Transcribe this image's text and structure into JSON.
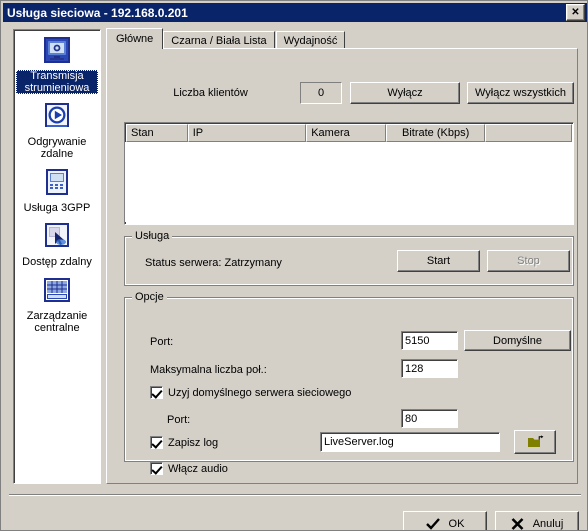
{
  "window": {
    "title": "Usługa sieciowa - 192.168.0.201",
    "close_label": "✕",
    "titlebar_color": "#0a246a",
    "face_color": "#d4d0c8"
  },
  "sidebar": {
    "items": [
      {
        "label": "Transmisja strumieniowa",
        "icon": "streaming-monitor-icon",
        "selected": true
      },
      {
        "label": "Odgrywanie zdalne",
        "icon": "play-circle-icon",
        "selected": false
      },
      {
        "label": "Usługa 3GPP",
        "icon": "mobile-phone-icon",
        "selected": false
      },
      {
        "label": "Dostęp zdalny",
        "icon": "remote-cursor-icon",
        "selected": false
      },
      {
        "label": "Zarządzanie centralne",
        "icon": "server-rack-icon",
        "selected": false
      }
    ]
  },
  "tabs": [
    {
      "label": "Główne",
      "active": true
    },
    {
      "label": "Czarna / Biała Lista",
      "active": false
    },
    {
      "label": "Wydajność",
      "active": false
    }
  ],
  "main": {
    "clients_button": "Liczba klientów",
    "clients_count": "0",
    "disconnect_button": "Wyłącz",
    "disconnect_all_button": "Wyłącz wszystkich",
    "table": {
      "columns": [
        "Stan",
        "IP",
        "Kamera",
        "Bitrate (Kbps)",
        ""
      ],
      "rows": []
    },
    "service_group": {
      "title": "Usługa",
      "status_label": "Status serwera: Zatrzymany",
      "start_button": "Start",
      "stop_button": "Stop",
      "stop_disabled": true
    },
    "options_group": {
      "title": "Opcje",
      "port_label": "Port:",
      "port_value": "5150",
      "defaults_button": "Domyślne",
      "max_conn_label": "Maksymalna liczba poł.:",
      "max_conn_value": "128",
      "use_default_web_label": "Uzyj domyślnego serwera sieciowego",
      "use_default_web_checked": true,
      "web_port_label": "Port:",
      "web_port_value": "80",
      "save_log_label": "Zapisz log",
      "save_log_checked": true,
      "log_file_value": "LiveServer.log",
      "browse_icon": "open-folder-icon",
      "enable_audio_label": "Włącz audio",
      "enable_audio_checked": true
    }
  },
  "footer": {
    "ok_button": "OK",
    "ok_icon": "checkmark-icon",
    "cancel_button": "Anuluj",
    "cancel_icon": "cross-icon"
  }
}
